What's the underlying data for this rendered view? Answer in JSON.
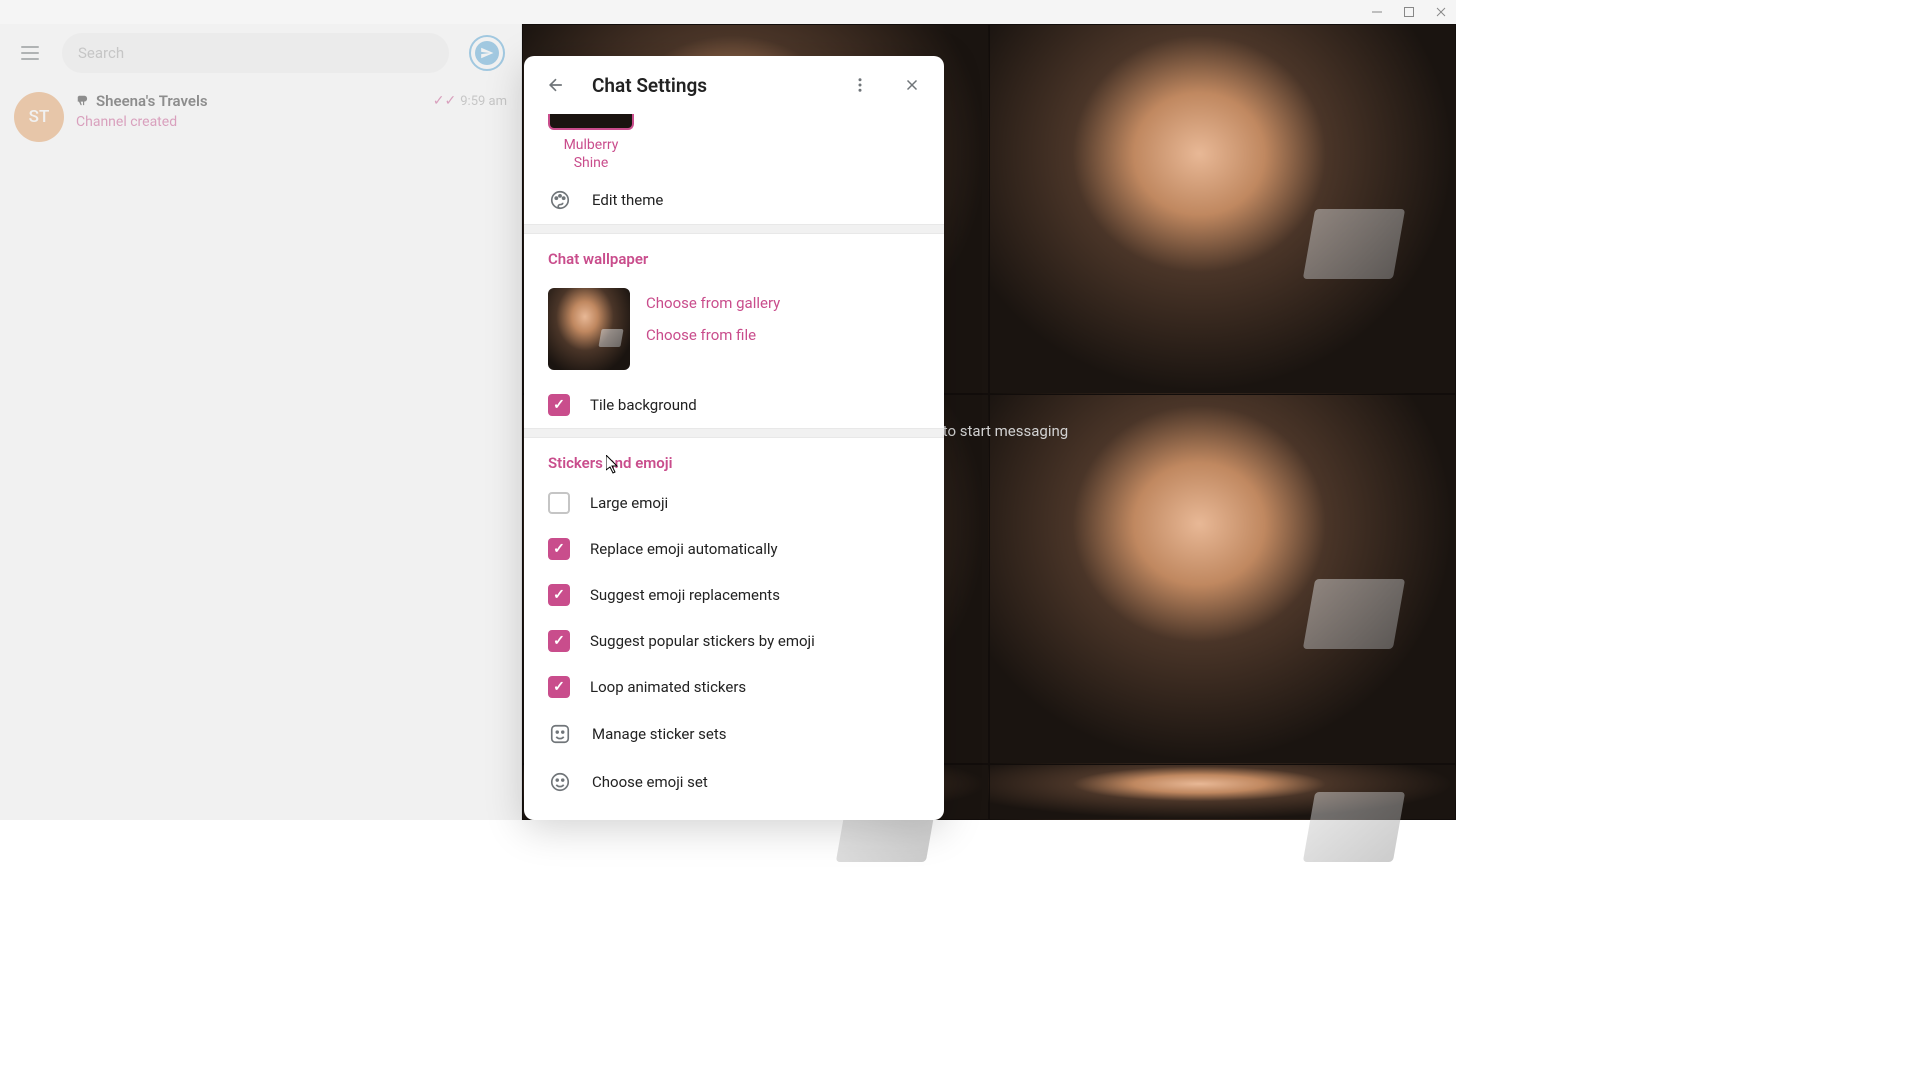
{
  "search": {
    "placeholder": "Search"
  },
  "chat_list": {
    "item": {
      "avatar_initials": "ST",
      "name": "Sheena's Travels",
      "time": "9:59 am",
      "preview": "Channel created"
    }
  },
  "content": {
    "placeholder": "chat to start messaging"
  },
  "modal": {
    "title": "Chat Settings",
    "theme_name": "Mulberry Shine",
    "edit_theme": "Edit theme",
    "wallpaper_section": "Chat wallpaper",
    "choose_gallery": "Choose from gallery",
    "choose_file": "Choose from file",
    "tile_bg": "Tile background",
    "stickers_section": "Stickers and emoji",
    "large_emoji": "Large emoji",
    "replace_emoji": "Replace emoji automatically",
    "suggest_emoji": "Suggest emoji replacements",
    "suggest_stickers": "Suggest popular stickers by emoji",
    "loop_stickers": "Loop animated stickers",
    "manage_stickers": "Manage sticker sets",
    "choose_emoji": "Choose emoji set"
  }
}
